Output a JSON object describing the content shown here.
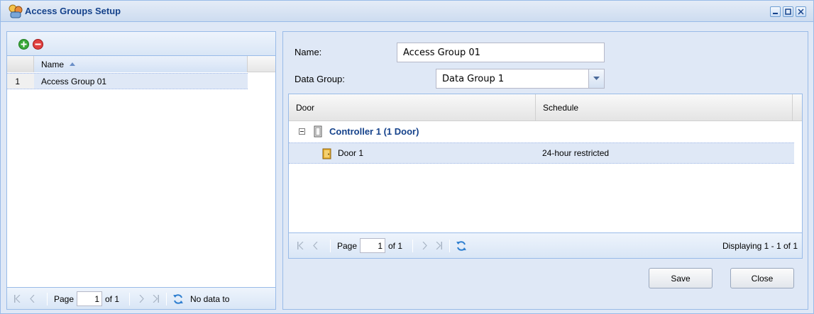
{
  "window": {
    "title": "Access Groups Setup"
  },
  "left_grid": {
    "column_header": "Name",
    "rows": [
      {
        "num": "1",
        "name": "Access Group 01"
      }
    ],
    "pager": {
      "page_label": "Page",
      "page_value": "1",
      "of_label": "of 1",
      "status": "No data to"
    }
  },
  "form": {
    "name_label": "Name:",
    "name_value": "Access Group 01",
    "data_group_label": "Data Group:",
    "data_group_value": "Data Group 1"
  },
  "door_grid": {
    "columns": [
      "Door",
      "Schedule"
    ],
    "group": "Controller 1 (1 Door)",
    "rows": [
      {
        "door": "Door 1",
        "schedule": "24-hour restricted"
      }
    ],
    "pager": {
      "page_label": "Page",
      "page_value": "1",
      "of_label": "of 1",
      "status": "Displaying 1 - 1 of 1"
    }
  },
  "buttons": {
    "save": "Save",
    "close": "Close"
  },
  "colors": {
    "title_blue": "#15428b",
    "panel_bg": "#dfe8f6",
    "border_blue": "#99bbe8",
    "add_green": "#3aa83a",
    "remove_red": "#e04040",
    "refresh_blue": "#2f7fd0"
  },
  "icons": [
    "app-icon",
    "add-icon",
    "remove-icon",
    "sort-asc-icon",
    "first-page-icon",
    "prev-page-icon",
    "next-page-icon",
    "last-page-icon",
    "refresh-icon",
    "collapse-icon",
    "controller-icon",
    "door-icon",
    "combo-arrow-icon",
    "minimize-icon",
    "maximize-icon",
    "close-icon"
  ]
}
